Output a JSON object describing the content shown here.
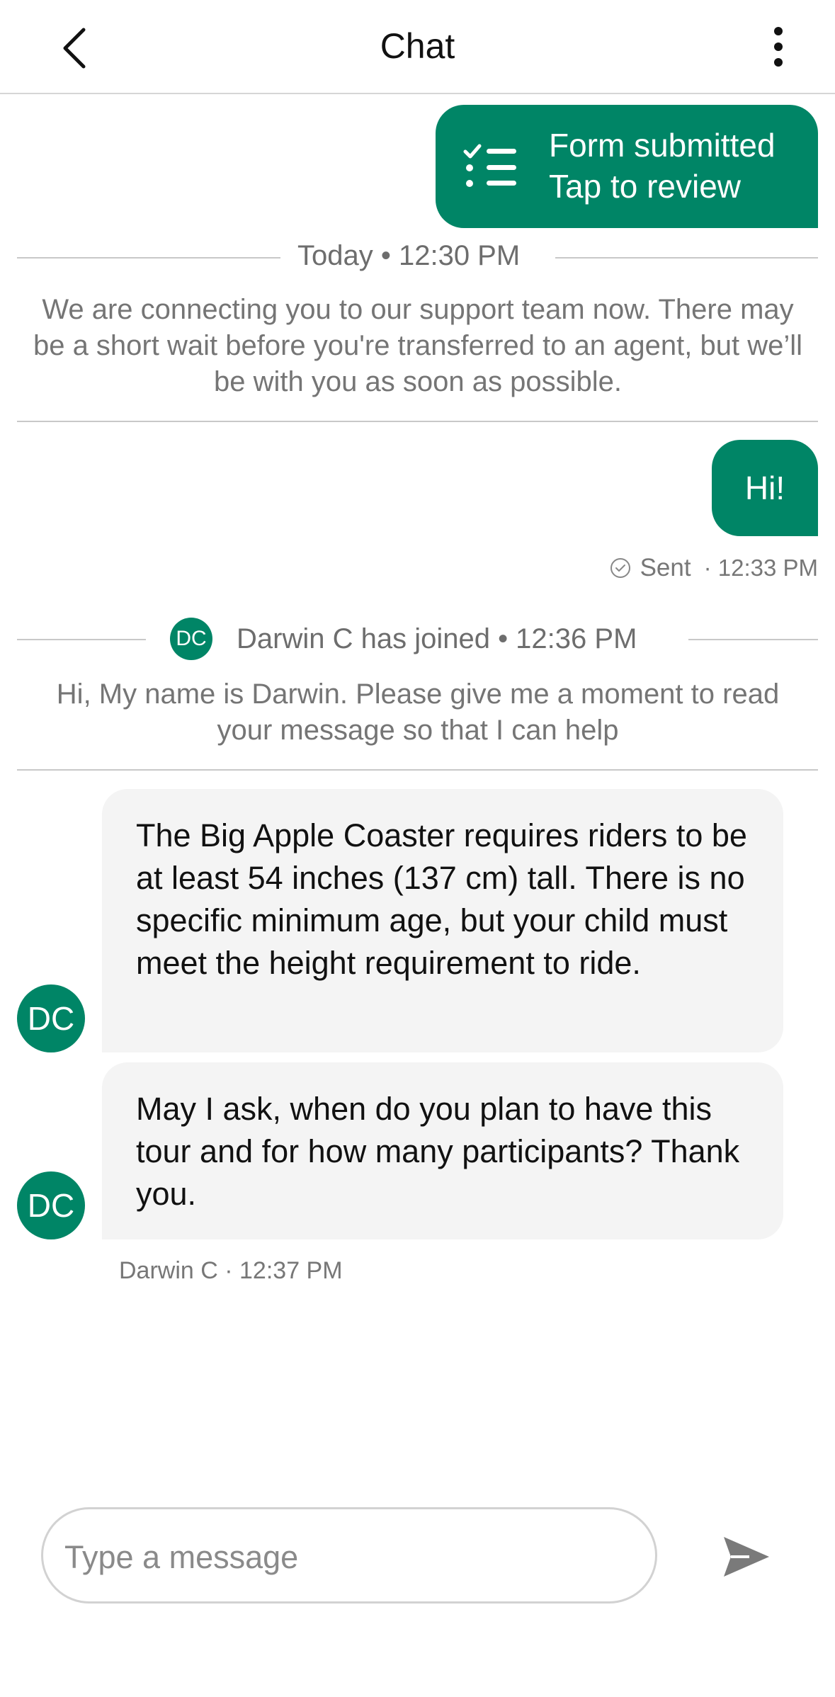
{
  "header": {
    "title": "Chat",
    "back_icon": "chevron-left-icon",
    "menu_icon": "more-vertical-icon"
  },
  "form_card": {
    "line1": "Form submitted",
    "line2": "Tap to review",
    "icon": "checklist-icon"
  },
  "system": {
    "today_label": "Today • 12:30 PM",
    "connecting_text": "We are connecting you to our support team now. There may be a short wait before you're transferred to an agent, but we’ll be with you as soon as possible.",
    "joined_initials": "DC",
    "joined_label": "Darwin C has joined • 12:36 PM",
    "intro_text": "Hi, My name is Darwin. Please give me a moment to read your message so that I can help"
  },
  "outgoing": {
    "text": "Hi!",
    "status": "Sent",
    "time": "· 12:33 PM",
    "status_icon": "check-circle-icon"
  },
  "incoming": [
    {
      "initials": "DC",
      "text": "The Big Apple Coaster requires riders to be at least 54 inches (137 cm) tall. There is no specific minimum age, but your child must meet the height requirement to ride."
    },
    {
      "initials": "DC",
      "text": "May I ask, when do you plan to have this tour and for how many participants? Thank you."
    }
  ],
  "incoming_meta": "Darwin C · 12:37 PM",
  "composer": {
    "placeholder": "Type a message",
    "value": "",
    "send_icon": "send-icon"
  },
  "colors": {
    "brand": "#008566",
    "incoming_bg": "#f4f4f4",
    "muted_text": "#757575"
  }
}
